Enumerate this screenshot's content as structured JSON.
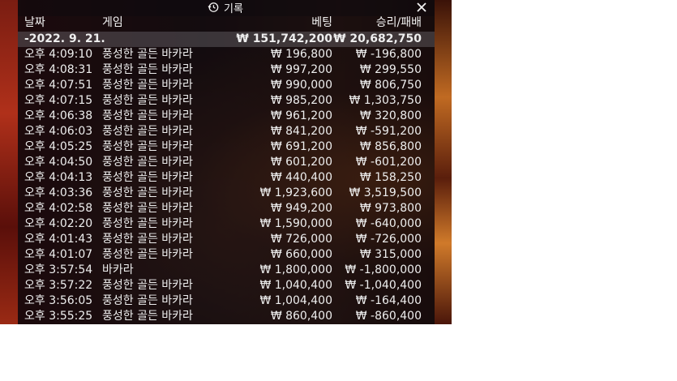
{
  "header": {
    "title": "기록",
    "col_date": "날짜",
    "col_game": "게임",
    "col_bet": "베팅",
    "col_result": "승리/패배"
  },
  "total": {
    "date": "-2022. 9. 21.",
    "bet": "₩ 151,742,200",
    "result": "₩ 20,682,750"
  },
  "rows": [
    {
      "time": "오후 4:09:10",
      "game": "풍성한 골든 바카라",
      "bet": "₩ 196,800",
      "result": "₩ -196,800"
    },
    {
      "time": "오후 4:08:31",
      "game": "풍성한 골든 바카라",
      "bet": "₩ 997,200",
      "result": "₩ 299,550"
    },
    {
      "time": "오후 4:07:51",
      "game": "풍성한 골든 바카라",
      "bet": "₩ 990,000",
      "result": "₩ 806,750"
    },
    {
      "time": "오후 4:07:15",
      "game": "풍성한 골든 바카라",
      "bet": "₩ 985,200",
      "result": "₩ 1,303,750"
    },
    {
      "time": "오후 4:06:38",
      "game": "풍성한 골든 바카라",
      "bet": "₩ 961,200",
      "result": "₩ 320,800"
    },
    {
      "time": "오후 4:06:03",
      "game": "풍성한 골든 바카라",
      "bet": "₩ 841,200",
      "result": "₩ -591,200"
    },
    {
      "time": "오후 4:05:25",
      "game": "풍성한 골든 바카라",
      "bet": "₩ 691,200",
      "result": "₩ 856,800"
    },
    {
      "time": "오후 4:04:50",
      "game": "풍성한 골든 바카라",
      "bet": "₩ 601,200",
      "result": "₩ -601,200"
    },
    {
      "time": "오후 4:04:13",
      "game": "풍성한 골든 바카라",
      "bet": "₩ 440,400",
      "result": "₩ 158,250"
    },
    {
      "time": "오후 4:03:36",
      "game": "풍성한 골든 바카라",
      "bet": "₩ 1,923,600",
      "result": "₩ 3,519,500"
    },
    {
      "time": "오후 4:02:58",
      "game": "풍성한 골든 바카라",
      "bet": "₩ 949,200",
      "result": "₩ 973,800"
    },
    {
      "time": "오후 4:02:20",
      "game": "풍성한 골든 바카라",
      "bet": "₩ 1,590,000",
      "result": "₩ -640,000"
    },
    {
      "time": "오후 4:01:43",
      "game": "풍성한 골든 바카라",
      "bet": "₩ 726,000",
      "result": "₩ -726,000"
    },
    {
      "time": "오후 4:01:07",
      "game": "풍성한 골든 바카라",
      "bet": "₩ 660,000",
      "result": "₩ 315,000"
    },
    {
      "time": "오후 3:57:54",
      "game": "바카라",
      "bet": "₩ 1,800,000",
      "result": "₩ -1,800,000"
    },
    {
      "time": "오후 3:57:22",
      "game": "풍성한 골든 바카라",
      "bet": "₩ 1,040,400",
      "result": "₩ -1,040,400"
    },
    {
      "time": "오후 3:56:05",
      "game": "풍성한 골든 바카라",
      "bet": "₩ 1,004,400",
      "result": "₩ -164,400"
    },
    {
      "time": "오후 3:55:25",
      "game": "풍성한 골든 바카라",
      "bet": "₩ 860,400",
      "result": "₩ -860,400"
    }
  ],
  "icons": {
    "history": "history-clock-icon",
    "close": "close-icon"
  }
}
